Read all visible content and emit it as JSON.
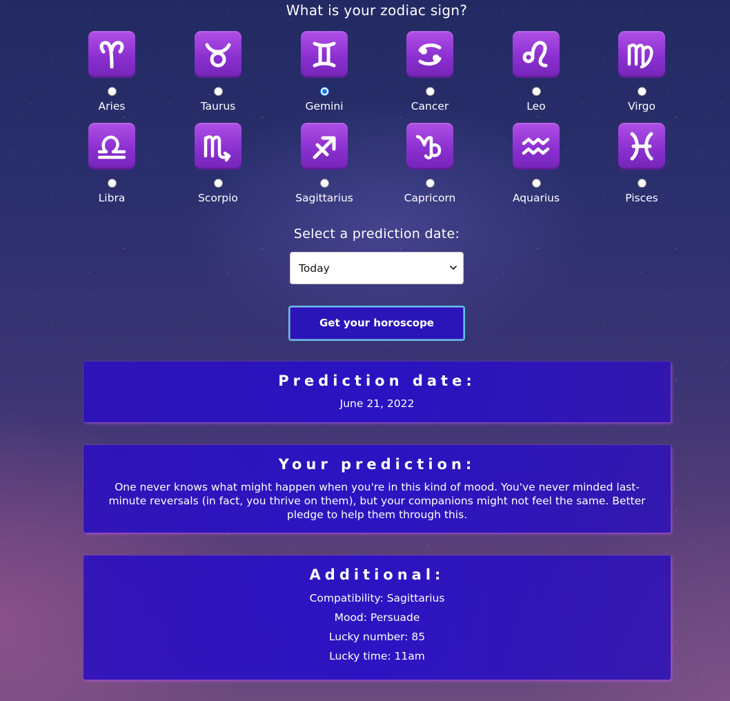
{
  "question": "What is your zodiac sign?",
  "signs": [
    {
      "name": "Aries",
      "icon": "aries-icon",
      "glyph": "♈",
      "checked": false
    },
    {
      "name": "Taurus",
      "icon": "taurus-icon",
      "glyph": "♉",
      "checked": false
    },
    {
      "name": "Gemini",
      "icon": "gemini-icon",
      "glyph": "♊",
      "checked": true
    },
    {
      "name": "Cancer",
      "icon": "cancer-icon",
      "glyph": "♋",
      "checked": false
    },
    {
      "name": "Leo",
      "icon": "leo-icon",
      "glyph": "♌",
      "checked": false
    },
    {
      "name": "Virgo",
      "icon": "virgo-icon",
      "glyph": "♍",
      "checked": false
    },
    {
      "name": "Libra",
      "icon": "libra-icon",
      "glyph": "♎",
      "checked": false
    },
    {
      "name": "Scorpio",
      "icon": "scorpio-icon",
      "glyph": "♏",
      "checked": false
    },
    {
      "name": "Sagittarius",
      "icon": "sagittarius-icon",
      "glyph": "♐",
      "checked": false
    },
    {
      "name": "Capricorn",
      "icon": "capricorn-icon",
      "glyph": "♑",
      "checked": false
    },
    {
      "name": "Aquarius",
      "icon": "aquarius-icon",
      "glyph": "♒",
      "checked": false
    },
    {
      "name": "Pisces",
      "icon": "pisces-icon",
      "glyph": "♓",
      "checked": false
    }
  ],
  "date_select": {
    "label": "Select a prediction date:",
    "value": "Today"
  },
  "submit_button": "Get your horoscope",
  "prediction_date": {
    "heading": "Prediction date:",
    "value": "June 21, 2022"
  },
  "prediction": {
    "heading": "Your prediction:",
    "text": "One never knows what might happen when you're in this kind of mood. You've never minded last-minute reversals (in fact, you thrive on them), but your companions might not feel the same. Better pledge to help them through this."
  },
  "additional": {
    "heading": "Additional:",
    "compatibility": "Compatibility: Sagittarius",
    "mood": "Mood: Persuade",
    "lucky_number": "Lucky number: 85",
    "lucky_time": "Lucky time: 11am"
  },
  "colors": {
    "tile": "#9b3ddb",
    "button_bg": "#2a15b8",
    "button_border": "#5fc3e8",
    "card_bg": "#2c10be",
    "radio_checked": "#1a73e8"
  }
}
